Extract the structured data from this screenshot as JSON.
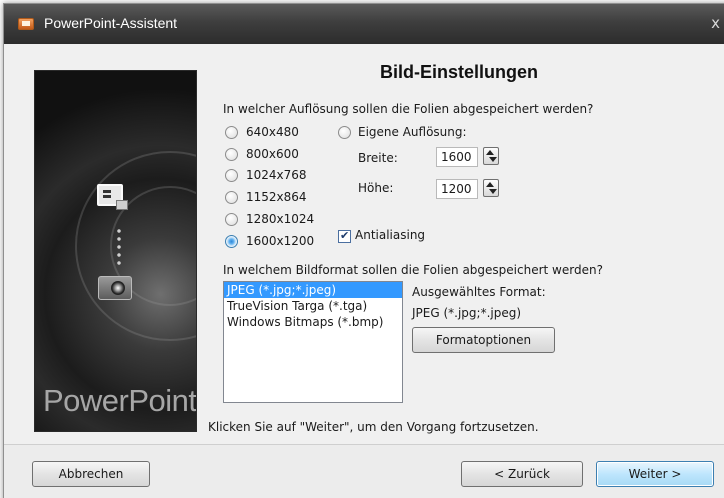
{
  "window": {
    "title": "PowerPoint-Assistent",
    "close_glyph": "x"
  },
  "banner": {
    "brand_text": "PowerPoint",
    "icons": [
      "slide-icon",
      "photo-icon"
    ]
  },
  "heading": "Bild-Einstellungen",
  "resolution": {
    "question": "In welcher Auflösung sollen die Folien abgespeichert werden?",
    "options": [
      {
        "label": "640x480",
        "selected": false
      },
      {
        "label": "800x600",
        "selected": false
      },
      {
        "label": "1024x768",
        "selected": false
      },
      {
        "label": "1152x864",
        "selected": false
      },
      {
        "label": "1280x1024",
        "selected": false
      },
      {
        "label": "1600x1200",
        "selected": true
      }
    ],
    "custom_label": "Eigene Auflösung:",
    "custom_selected": false,
    "width_label": "Breite:",
    "width_value": "1600",
    "height_label": "Höhe:",
    "height_value": "1200",
    "antialiasing_label": "Antialiasing",
    "antialiasing_checked": true
  },
  "format": {
    "question": "In welchem Bildformat sollen die Folien abgespeichert werden?",
    "items": [
      {
        "label": "JPEG (*.jpg;*.jpeg)",
        "selected": true
      },
      {
        "label": "TrueVision Targa (*.tga)",
        "selected": false
      },
      {
        "label": "Windows Bitmaps (*.bmp)",
        "selected": false
      }
    ],
    "selected_format_label": "Ausgewähltes Format:",
    "selected_format_value": "JPEG (*.jpg;*.jpeg)",
    "options_button": "Formatoptionen"
  },
  "instruction": "Klicken Sie auf \"Weiter\", um den Vorgang fortzusetzen.",
  "buttons": {
    "cancel": "Abbrechen",
    "back": "< Zurück",
    "next": "Weiter >"
  },
  "colors": {
    "selection": "#3399ff",
    "titlebar": "#3e3e3e",
    "default_button": "#bee6fd"
  }
}
